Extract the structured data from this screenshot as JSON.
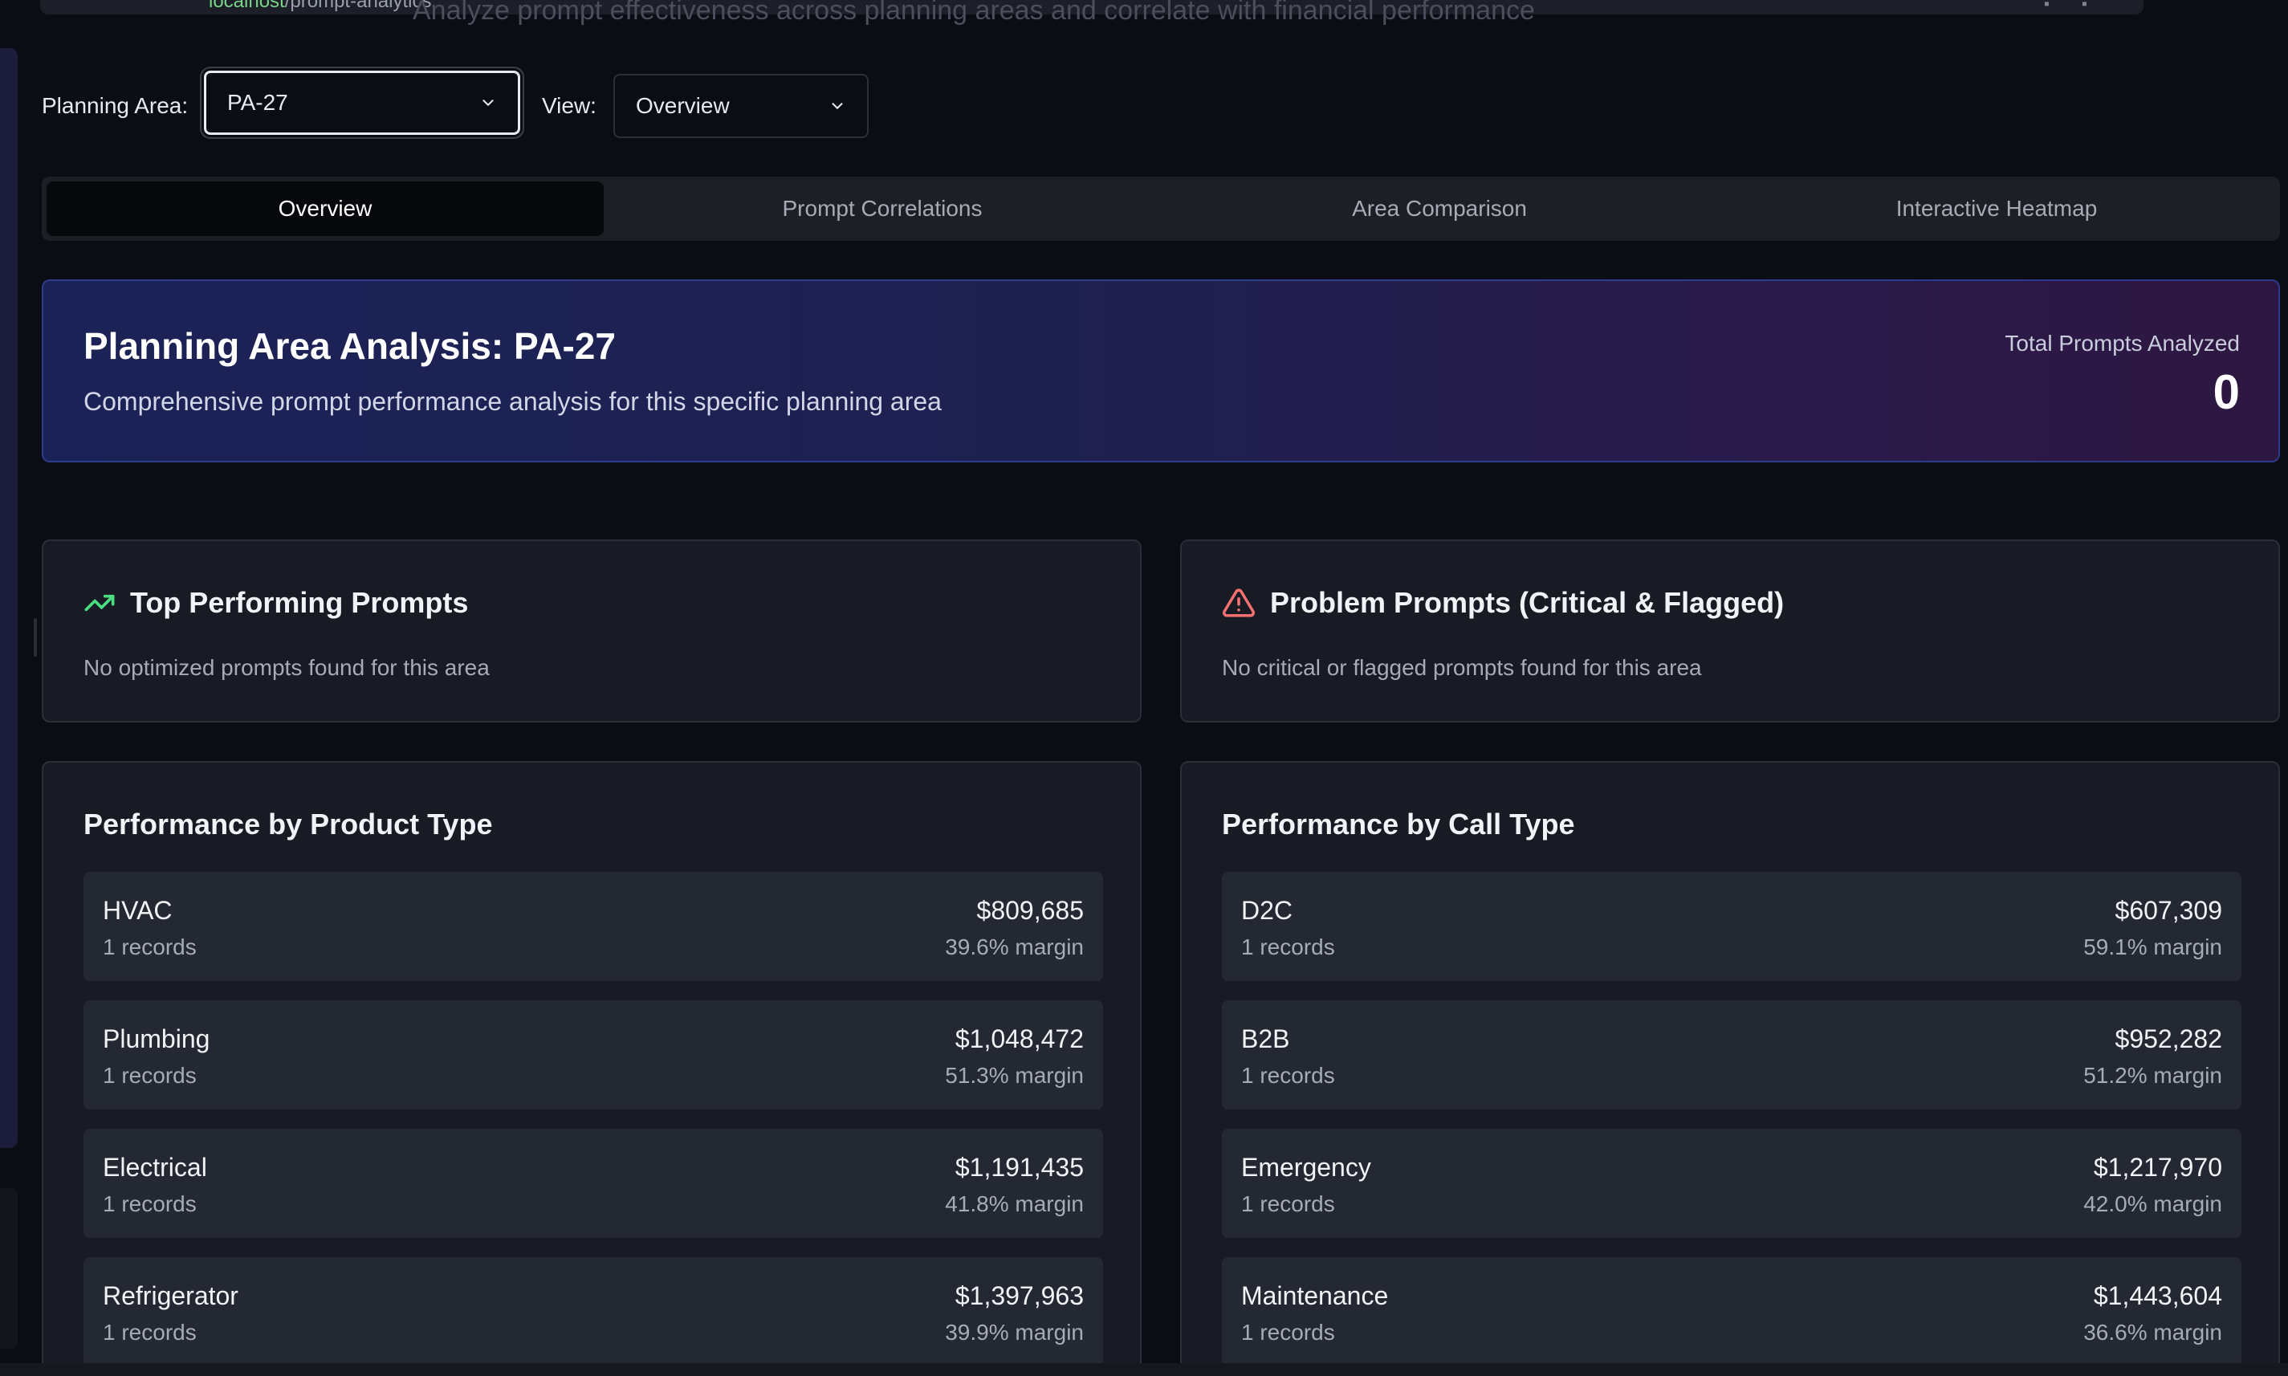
{
  "browser": {
    "url_host": "localhost",
    "url_path": "/prompt-analytics"
  },
  "page": {
    "subtitle": "Analyze prompt effectiveness across planning areas and correlate with financial performance"
  },
  "filters": {
    "planning_area_label": "Planning Area:",
    "planning_area_value": "PA-27",
    "view_label": "View:",
    "view_value": "Overview"
  },
  "tabs": [
    {
      "label": "Overview",
      "active": true
    },
    {
      "label": "Prompt Correlations",
      "active": false
    },
    {
      "label": "Area Comparison",
      "active": false
    },
    {
      "label": "Interactive Heatmap",
      "active": false
    }
  ],
  "hero": {
    "title": "Planning Area Analysis: PA-27",
    "description": "Comprehensive prompt performance analysis for this specific planning area",
    "metric_label": "Total Prompts Analyzed",
    "metric_value": "0"
  },
  "top_prompts": {
    "title": "Top Performing Prompts",
    "icon": "trending-up-icon",
    "empty": "No optimized prompts found for this area"
  },
  "problem_prompts": {
    "title": "Problem Prompts (Critical & Flagged)",
    "icon": "alert-triangle-icon",
    "empty": "No critical or flagged prompts found for this area"
  },
  "product_type": {
    "title": "Performance by Product Type",
    "rows": [
      {
        "name": "HVAC",
        "records": "1 records",
        "value": "$809,685",
        "margin": "39.6% margin"
      },
      {
        "name": "Plumbing",
        "records": "1 records",
        "value": "$1,048,472",
        "margin": "51.3% margin"
      },
      {
        "name": "Electrical",
        "records": "1 records",
        "value": "$1,191,435",
        "margin": "41.8% margin"
      },
      {
        "name": "Refrigerator",
        "records": "1 records",
        "value": "$1,397,963",
        "margin": "39.9% margin"
      }
    ]
  },
  "call_type": {
    "title": "Performance by Call Type",
    "rows": [
      {
        "name": "D2C",
        "records": "1 records",
        "value": "$607,309",
        "margin": "59.1% margin"
      },
      {
        "name": "B2B",
        "records": "1 records",
        "value": "$952,282",
        "margin": "51.2% margin"
      },
      {
        "name": "Emergency",
        "records": "1 records",
        "value": "$1,217,970",
        "margin": "42.0% margin"
      },
      {
        "name": "Maintenance",
        "records": "1 records",
        "value": "$1,443,604",
        "margin": "36.6% margin"
      }
    ]
  },
  "colors": {
    "accent_green": "#4ade80",
    "accent_red": "#f87171",
    "hero_border": "#2e3a8a"
  }
}
